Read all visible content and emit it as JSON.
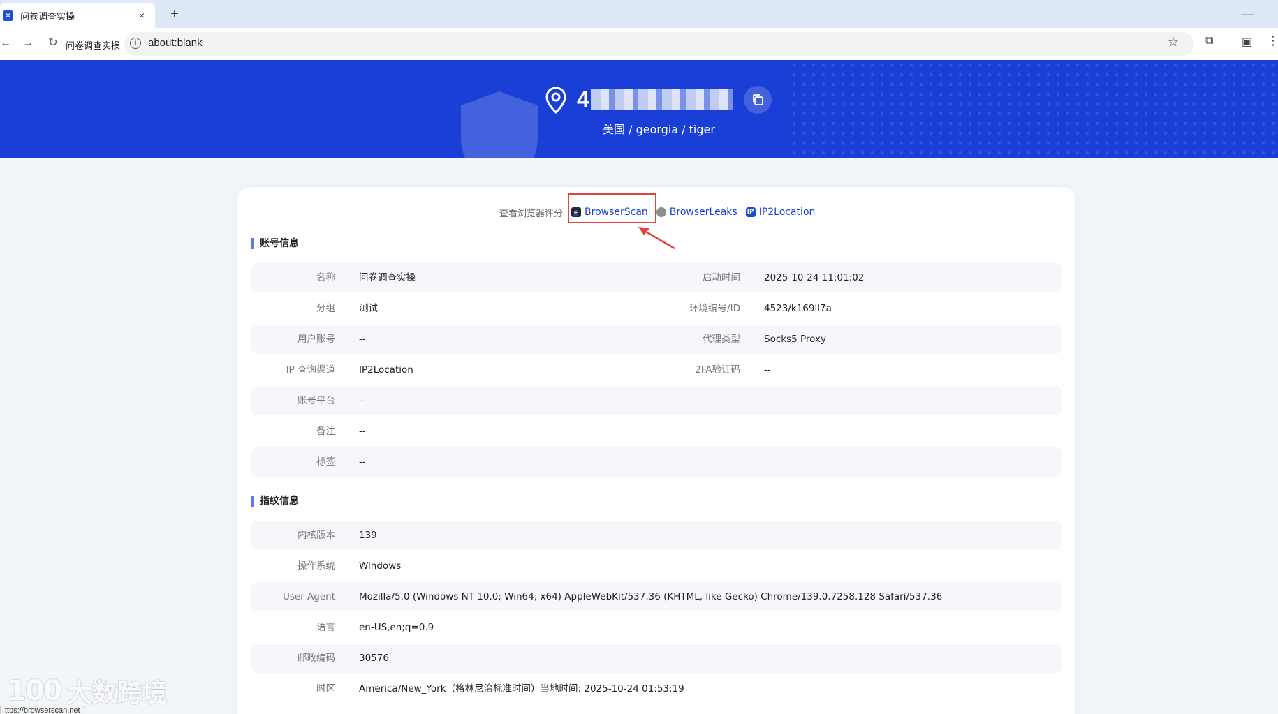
{
  "browser": {
    "tab_title": "问卷调查实操",
    "tab_favicon": "bs-logo-icon",
    "close_glyph": "×",
    "new_tab_glyph": "+",
    "minimize_glyph": "—",
    "toolbar_profile_name": "问卷调查实操",
    "url": "about:blank",
    "status_url": "ttps://browserscan.net"
  },
  "banner": {
    "ip_visible_prefix": "4",
    "location": "美国 / georgia / tiger",
    "background_color": "#1a3fd6"
  },
  "score_links": {
    "label": "查看浏览器评分",
    "items": [
      {
        "name": "BrowserScan",
        "icon": "browserscan-icon"
      },
      {
        "name": "BrowserLeaks",
        "icon": "browserleaks-icon"
      },
      {
        "name": "IP2Location",
        "icon": "ip2location-icon",
        "icon_text": "IP"
      }
    ],
    "highlight_color": "#e2443c"
  },
  "account_section": {
    "title": "账号信息",
    "rows": [
      {
        "label": "名称",
        "value": "问卷调查实操",
        "label2": "启动时间",
        "value2": "2025-10-24 11:01:02"
      },
      {
        "label": "分组",
        "value": "测试",
        "label2": "环境编号/ID",
        "value2": "4523/k169ll7a"
      },
      {
        "label": "用户账号",
        "value": "--",
        "label2": "代理类型",
        "value2": "Socks5 Proxy"
      },
      {
        "label": "IP 查询渠道",
        "value": "IP2Location",
        "label2": "2FA验证码",
        "value2": "--"
      },
      {
        "label": "账号平台",
        "value": "--"
      },
      {
        "label": "备注",
        "value": "--"
      },
      {
        "label": "标签",
        "value": "--"
      }
    ]
  },
  "fingerprint_section": {
    "title": "指纹信息",
    "rows": [
      {
        "label": "内核版本",
        "value": "139"
      },
      {
        "label": "操作系统",
        "value": "Windows"
      },
      {
        "label": "User Agent",
        "value": "Mozilla/5.0 (Windows NT 10.0; Win64; x64) AppleWebKit/537.36 (KHTML, like Gecko) Chrome/139.0.7258.128 Safari/537.36"
      },
      {
        "label": "语言",
        "value": "en-US,en;q=0.9"
      },
      {
        "label": "邮政编码",
        "value": "30576"
      },
      {
        "label": "时区",
        "value": "America/New_York（格林尼治标准时间）当地时间: 2025-10-24 01:53:19"
      }
    ]
  },
  "watermark": {
    "mark": "100",
    "text": "大数跨境"
  }
}
